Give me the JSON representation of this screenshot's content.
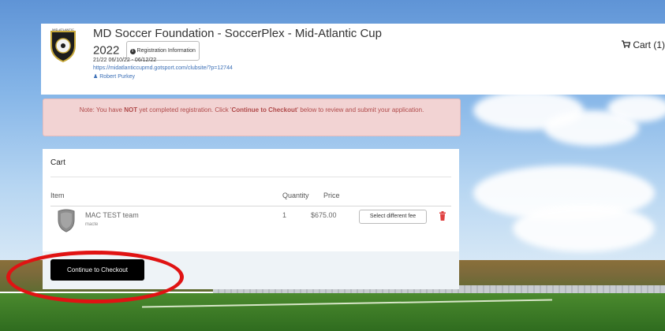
{
  "header": {
    "title": "MD Soccer Foundation - SoccerPlex - Mid-Atlantic Cup",
    "year": "2022",
    "registration_info_label": "Registration Information",
    "dates": "21/22 06/10/22 - 06/12/22",
    "link": "https://midatlanticcupmd.gotsport.com/clubsite/?p=12744",
    "contact": "Robert Purkey",
    "cart_label": "Cart (1)",
    "logo_text": "MID-ATLANTIC"
  },
  "alert": {
    "prefix": "Note: You have ",
    "emphasis_not": "NOT",
    "middle": " yet completed registration. Click '",
    "emphasis_action": "Continue to Checkout",
    "suffix": "' below to review and submit your application."
  },
  "cart": {
    "heading": "Cart",
    "columns": [
      "Item",
      "Quantity",
      "Price"
    ],
    "items": [
      {
        "name": "MAC TEST team",
        "sub": "macte",
        "quantity": "1",
        "price": "$675.00",
        "fee_button_label": "Select different fee"
      }
    ],
    "checkout_label": "Continue to Checkout"
  },
  "colors": {
    "alert_bg": "#f2d3d3",
    "alert_text": "#b04a4a",
    "link": "#3b6fb6",
    "checkout_bg": "#000000",
    "highlight": "#e01313"
  },
  "icons": {
    "reg_info": "info-circle-icon",
    "contact": "user-icon",
    "cart": "cart-icon",
    "item": "shield-icon",
    "delete": "trash-icon"
  }
}
